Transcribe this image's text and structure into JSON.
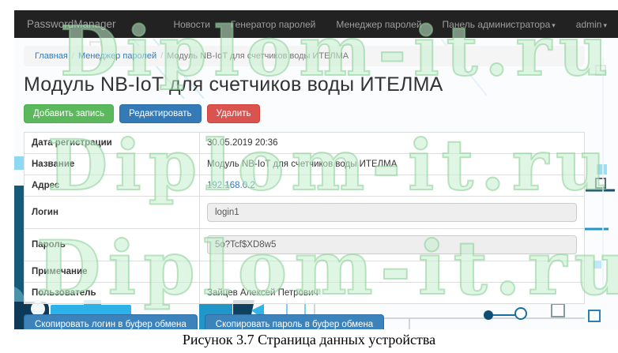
{
  "navbar": {
    "brand": "PasswordManager",
    "items": [
      {
        "label": "Новости",
        "dropdown": false
      },
      {
        "label": "Генератор паролей",
        "dropdown": false
      },
      {
        "label": "Менеджер паролей",
        "dropdown": false
      },
      {
        "label": "Панель администратора",
        "dropdown": true
      },
      {
        "label": "admin",
        "dropdown": true
      }
    ]
  },
  "icons": {
    "caret": "▾"
  },
  "breadcrumb": {
    "separator": "/",
    "items": [
      {
        "label": "Главная"
      },
      {
        "label": "Менеджер паролей"
      },
      {
        "label": "Модуль NB-IoT для счетчиков воды ИТЕЛМА"
      }
    ]
  },
  "page": {
    "title": "Модуль NB-IoT для счетчиков воды ИТЕЛМА"
  },
  "actions": {
    "add": "Добавить запись",
    "edit": "Редактировать",
    "delete": "Удалить"
  },
  "details": {
    "rows": [
      {
        "label": "Дата регистрации",
        "value": "30.05.2019 20:36",
        "type": "text"
      },
      {
        "label": "Название",
        "value": "Модуль NB-IoT для счетчиков воды ИТЕЛМА",
        "type": "text"
      },
      {
        "label": "Адрес",
        "value": "192.168.0.2",
        "type": "link"
      },
      {
        "label": "Логин",
        "value": "login1",
        "type": "input"
      },
      {
        "label": "Пароль",
        "value": "5o?Tcf$XD8w5",
        "type": "input"
      },
      {
        "label": "Примечание",
        "value": "",
        "type": "text"
      },
      {
        "label": "Пользователь",
        "value": "Зайцев Алексей Петрович",
        "type": "text"
      }
    ]
  },
  "copy_buttons": {
    "login": "Скопировать логин в буфер обмена",
    "password": "Скопировать пароль в буфер обмена"
  },
  "watermark": {
    "text": "Diplom-it.ru",
    "color": "#9fdcaa"
  },
  "caption": "Рисунок 3.7 Страница данных устройства",
  "colors": {
    "navbar_bg": "#222222",
    "link": "#337ab7",
    "btn_success": "#5cb85c",
    "btn_primary": "#337ab7",
    "btn_danger": "#d9534f",
    "input_bg": "#eeeeee",
    "breadcrumb_bg": "#f5f5f5"
  }
}
